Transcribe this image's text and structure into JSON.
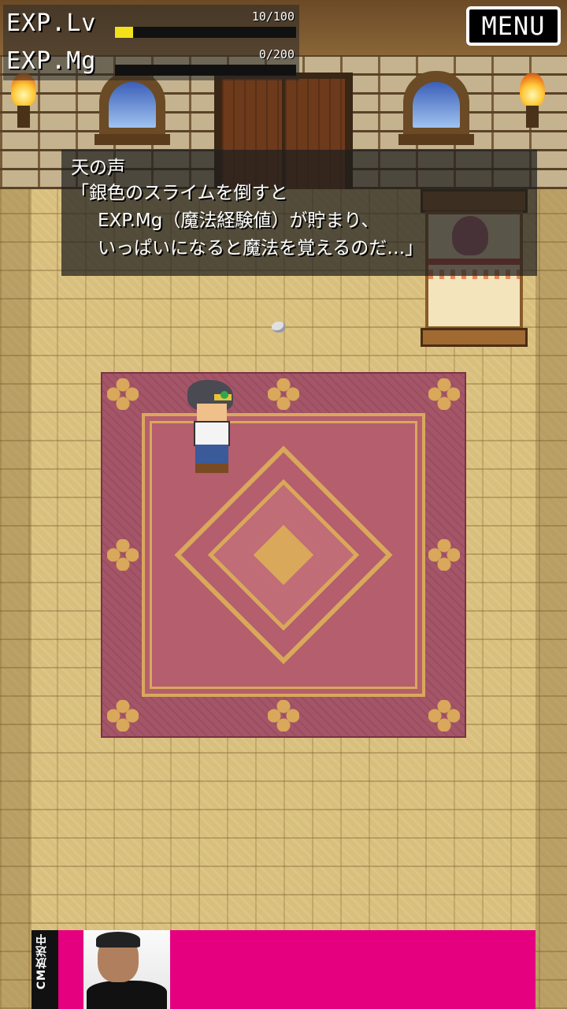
{
  "hud": {
    "lv": {
      "label": "EXP.Lv",
      "value": "10/100",
      "current": 10,
      "max": 100
    },
    "mg": {
      "label": "EXP.Mg",
      "value": "0/200",
      "current": 0,
      "max": 200
    },
    "bar_color": "#f2e21a"
  },
  "menu": {
    "label": "MENU"
  },
  "dialog": {
    "speaker": "天の声",
    "lines": [
      "「銀色のスライムを倒すと",
      "EXP.Mg（魔法経験値）が貯まり、",
      "いっぱいになると魔法を覚えるのだ…」"
    ]
  },
  "ad": {
    "tag": "CM放送中",
    "color": "#e5007f"
  }
}
